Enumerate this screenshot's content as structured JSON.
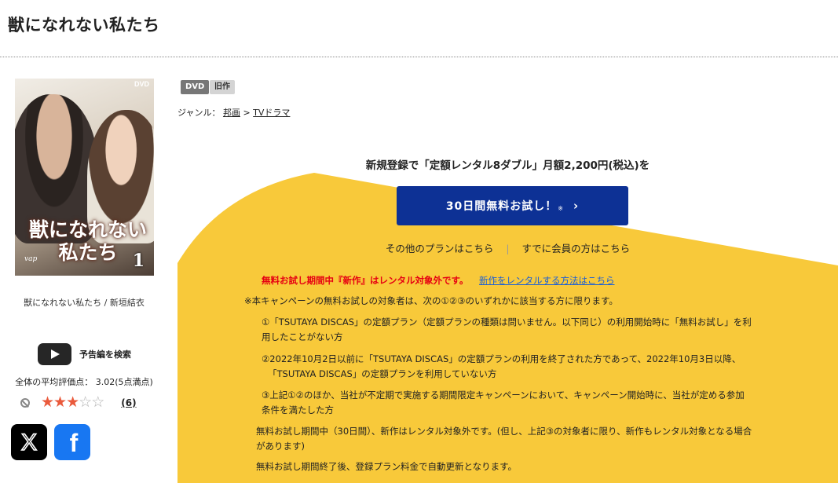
{
  "page": {
    "title": "獣になれない私たち"
  },
  "jacket": {
    "dvd_mark": "DVD",
    "logo_line1": "獣になれない",
    "logo_line2": "私たち",
    "volume": "1",
    "label": "vap"
  },
  "caption": "獣になれない私たち / 新垣結衣",
  "trailer": {
    "label": "予告編を検索",
    "icon": "youtube-play-icon"
  },
  "rating": {
    "summary": "全体の平均評価点： 3.02(5点満点)",
    "value": 3,
    "max": 5,
    "count": "(6)",
    "star_color": "#ea5a3c"
  },
  "share": {
    "x_icon": "x-logo-icon",
    "facebook_icon": "facebook-logo-icon",
    "x_glyph": "X",
    "fb_glyph": "f"
  },
  "badges": {
    "format": "DVD",
    "status": "旧作"
  },
  "genre": {
    "label": "ジャンル：",
    "crumb1": "邦画",
    "arrow": ">",
    "crumb2": "TVドラマ"
  },
  "promo": {
    "headline": "新規登録で「定額レンタル8ダブル」月額2,200円(税込)を",
    "cta_label": "30日間無料お試し！",
    "cta_note": "※",
    "cta_chevron": "›",
    "accent_color": "#f8c93a",
    "button_color": "#0d3195",
    "other_plans": "その他のプランはこちら",
    "separator": "|",
    "members": "すでに会員の方はこちら",
    "warning": "無料お試し期間中『新作』はレンタル対象外です。",
    "warning_link": "新作をレンタルする方法はこちら",
    "intro": "※本キャンペーンの無料お試しの対象者は、次の①②③のいずれかに該当する方に限ります。",
    "cond1_line1": "①「TSUTAYA DISCAS」の定額プラン（定額プランの種類は問いません。以下同じ）の利用開始時に「無料お試し」を利",
    "cond1_line2": "用したことがない方",
    "cond2_line1": "②2022年10月2日以前に「TSUTAYA DISCAS」の定額プランの利用を終了された方であって、2022年10月3日以降、",
    "cond2_line2": "「TSUTAYA DISCAS」の定額プランを利用していない方",
    "cond3_line1": "③上記①②のほか、当社が不定期で実施する期間限定キャンペーンにおいて、キャンペーン開始時に、当社が定める参加",
    "cond3_line2": "条件を満たした方",
    "note1_line1": "無料お試し期間中（30日間）、新作はレンタル対象外です。(但し、上記③の対象者に限り、新作もレンタル対象となる場合",
    "note1_line2": "があります)",
    "note2": "無料お試し期間終了後、登録プラン料金で自動更新となります。"
  }
}
